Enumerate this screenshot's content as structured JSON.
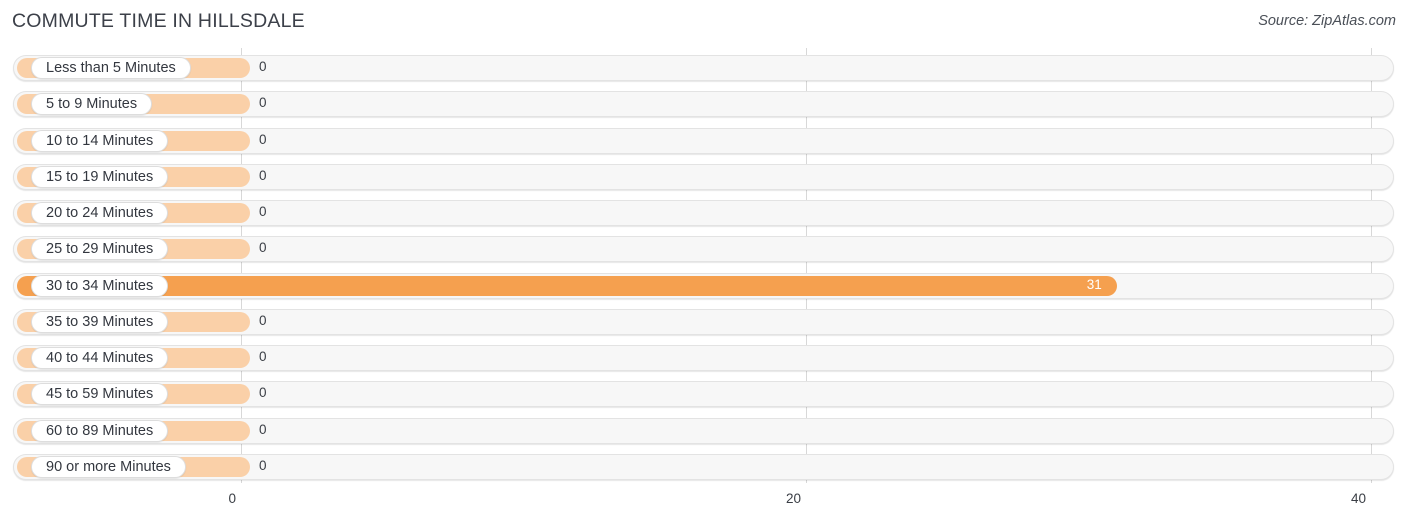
{
  "header": {
    "title": "COMMUTE TIME IN HILLSDALE",
    "source": "Source: ZipAtlas.com"
  },
  "colors": {
    "bar_low": "#fad0a8",
    "bar_high": "#f5a04f",
    "track": "#f7f7f7",
    "grid": "#d8d8d8",
    "text": "#3a3e45"
  },
  "chart_data": {
    "type": "bar",
    "orientation": "horizontal",
    "title": "COMMUTE TIME IN HILLSDALE",
    "xlabel": "",
    "ylabel": "",
    "xlim": [
      0,
      40
    ],
    "xticks": [
      0,
      20,
      40
    ],
    "xtick_labels": [
      "0",
      "20",
      "40"
    ],
    "grid": true,
    "legend": false,
    "categories": [
      "Less than 5 Minutes",
      "5 to 9 Minutes",
      "10 to 14 Minutes",
      "15 to 19 Minutes",
      "20 to 24 Minutes",
      "25 to 29 Minutes",
      "30 to 34 Minutes",
      "35 to 39 Minutes",
      "40 to 44 Minutes",
      "45 to 59 Minutes",
      "60 to 89 Minutes",
      "90 or more Minutes"
    ],
    "values": [
      0,
      0,
      0,
      0,
      0,
      0,
      31,
      0,
      0,
      0,
      0,
      0
    ],
    "value_labels": [
      "0",
      "0",
      "0",
      "0",
      "0",
      "0",
      "31",
      "0",
      "0",
      "0",
      "0",
      "0"
    ]
  }
}
